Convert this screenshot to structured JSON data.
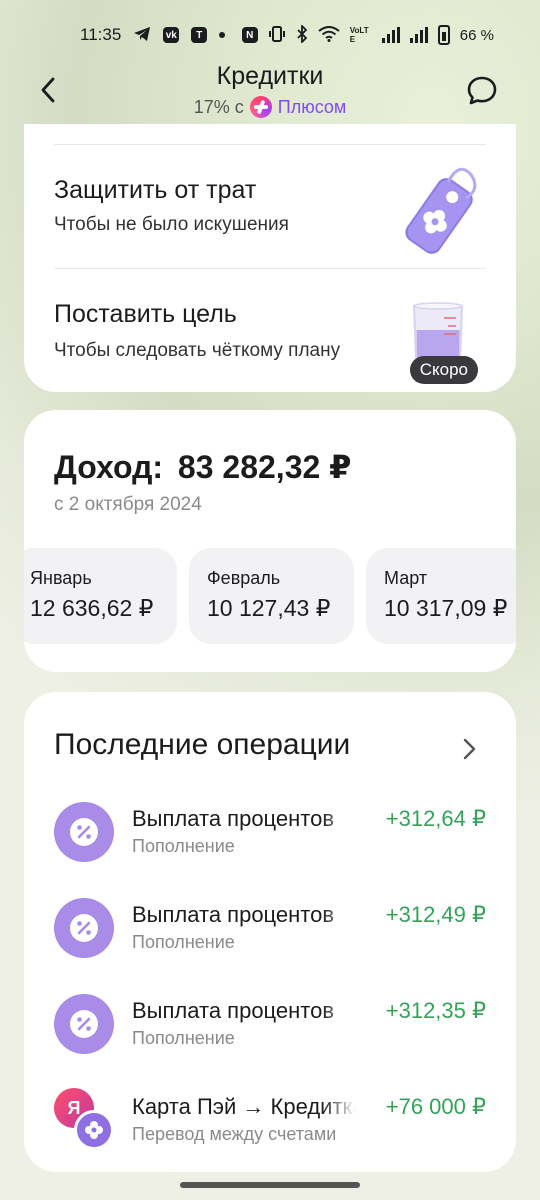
{
  "status_bar": {
    "time": "11:35",
    "app_icons": [
      "telegram-icon",
      "vk-icon",
      "tinkoff-icon",
      "dot-icon"
    ],
    "system_icons": [
      "nfc-icon",
      "vibrate-icon",
      "bluetooth-icon",
      "wifi-icon",
      "volte-icon",
      "signal-icon",
      "signal-icon",
      "battery-icon"
    ],
    "volte_label": "VoLTE",
    "battery_percent": "66 %"
  },
  "header": {
    "title": "Кредитки",
    "cashback_prefix": "17% с",
    "plus_label": "Плюсом"
  },
  "actions": [
    {
      "title": "Защитить от трат",
      "subtitle": "Чтобы не было искушения",
      "icon": "tag-lock-icon"
    },
    {
      "title": "Поставить цель",
      "subtitle": "Чтобы следовать чёткому плану",
      "icon": "beaker-icon",
      "badge": "Скоро"
    }
  ],
  "income": {
    "label": "Доход:",
    "amount": "83 282,32 ₽",
    "since": "с 2 октября 2024",
    "months": [
      {
        "name": "Январь",
        "amount": "12 636,62 ₽"
      },
      {
        "name": "Февраль",
        "amount": "10 127,43 ₽"
      },
      {
        "name": "Март",
        "amount": "10 317,09 ₽"
      }
    ]
  },
  "operations": {
    "title": "Последние операции",
    "items": [
      {
        "name": "Выплата процентов",
        "type": "Пополнение",
        "amount": "+312,64 ₽",
        "icon": "percent-icon"
      },
      {
        "name": "Выплата процентов",
        "type": "Пополнение",
        "amount": "+312,49 ₽",
        "icon": "percent-icon"
      },
      {
        "name": "Выплата процентов",
        "type": "Пополнение",
        "amount": "+312,35 ₽",
        "icon": "percent-icon"
      },
      {
        "name": "Карта Пэй → Кредитка",
        "type": "Перевод между счетами",
        "amount": "+76 000 ₽",
        "icon": "transfer-icon",
        "badge_letter": "Я"
      }
    ]
  },
  "colors": {
    "accent_plus": "#7f4cf5",
    "positive_amount": "#34a35a",
    "operation_icon_bg": "#a98be8"
  }
}
